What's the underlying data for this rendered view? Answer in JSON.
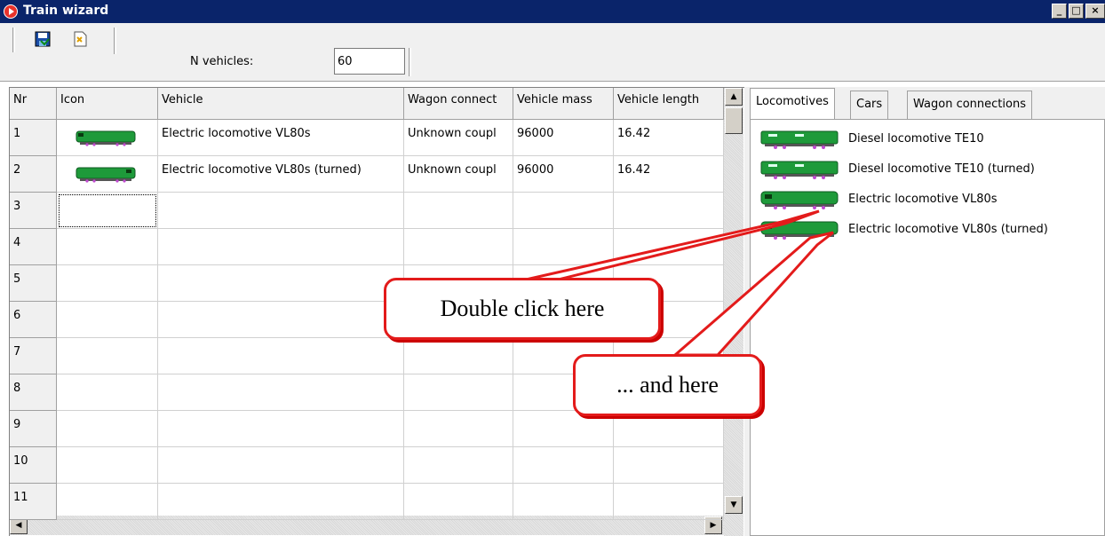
{
  "window": {
    "title": "Train wizard"
  },
  "toolbar": {
    "n_vehicles_label": "N vehicles:",
    "n_vehicles_value": "60"
  },
  "grid": {
    "columns": [
      "Nr",
      "Icon",
      "Vehicle",
      "Wagon connect",
      "Vehicle mass",
      "Vehicle length"
    ],
    "rows": [
      {
        "nr": "1",
        "vehicle": "Electric locomotive VL80s",
        "wagon": "Unknown coupl",
        "mass": "96000",
        "length": "16.42"
      },
      {
        "nr": "2",
        "vehicle": "Electric locomotive VL80s (turned)",
        "wagon": "Unknown coupl",
        "mass": "96000",
        "length": "16.42"
      },
      {
        "nr": "3",
        "vehicle": "",
        "wagon": "",
        "mass": "",
        "length": ""
      },
      {
        "nr": "4",
        "vehicle": "",
        "wagon": "",
        "mass": "",
        "length": ""
      },
      {
        "nr": "5",
        "vehicle": "",
        "wagon": "",
        "mass": "",
        "length": ""
      },
      {
        "nr": "6",
        "vehicle": "",
        "wagon": "",
        "mass": "",
        "length": ""
      },
      {
        "nr": "7",
        "vehicle": "",
        "wagon": "",
        "mass": "",
        "length": ""
      },
      {
        "nr": "8",
        "vehicle": "",
        "wagon": "",
        "mass": "",
        "length": ""
      },
      {
        "nr": "9",
        "vehicle": "",
        "wagon": "",
        "mass": "",
        "length": ""
      },
      {
        "nr": "10",
        "vehicle": "",
        "wagon": "",
        "mass": "",
        "length": ""
      },
      {
        "nr": "11",
        "vehicle": "",
        "wagon": "",
        "mass": "",
        "length": ""
      }
    ]
  },
  "tabs": [
    "Locomotives",
    "Cars",
    "Wagon connections"
  ],
  "catalog": [
    "Diesel locomotive TE10",
    "Diesel locomotive TE10 (turned)",
    "Electric locomotive VL80s",
    "Electric locomotive VL80s (turned)"
  ],
  "callouts": {
    "first": "Double click here",
    "second": "... and here"
  },
  "colors": {
    "titlebar": "#0a246a",
    "loco_green": "#1e9a3a",
    "callout_red": "#e31b1b"
  }
}
